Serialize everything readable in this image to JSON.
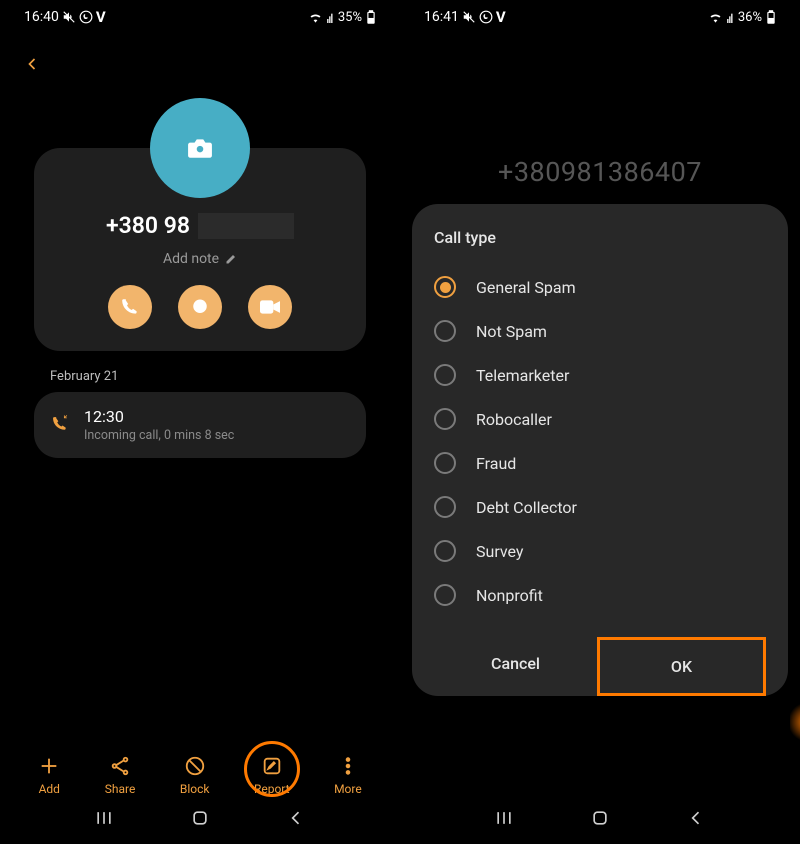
{
  "left": {
    "status": {
      "time": "16:40",
      "battery": "35%"
    },
    "phone_prefix": "+380 98",
    "add_note": "Add note",
    "date_header": "February 21",
    "call": {
      "time": "12:30",
      "detail": "Incoming call, 0 mins 8 sec"
    },
    "bottom": {
      "add": "Add",
      "share": "Share",
      "block": "Block",
      "report": "Report",
      "more": "More"
    }
  },
  "right": {
    "status": {
      "time": "16:41",
      "battery": "36%"
    },
    "dim_number": "+380981386407",
    "dialog": {
      "title": "Call type",
      "options": [
        {
          "label": "General Spam",
          "selected": true
        },
        {
          "label": "Not Spam",
          "selected": false
        },
        {
          "label": "Telemarketer",
          "selected": false
        },
        {
          "label": "Robocaller",
          "selected": false
        },
        {
          "label": "Fraud",
          "selected": false
        },
        {
          "label": "Debt Collector",
          "selected": false
        },
        {
          "label": "Survey",
          "selected": false
        },
        {
          "label": "Nonprofit",
          "selected": false
        }
      ],
      "cancel": "Cancel",
      "ok": "OK"
    }
  }
}
